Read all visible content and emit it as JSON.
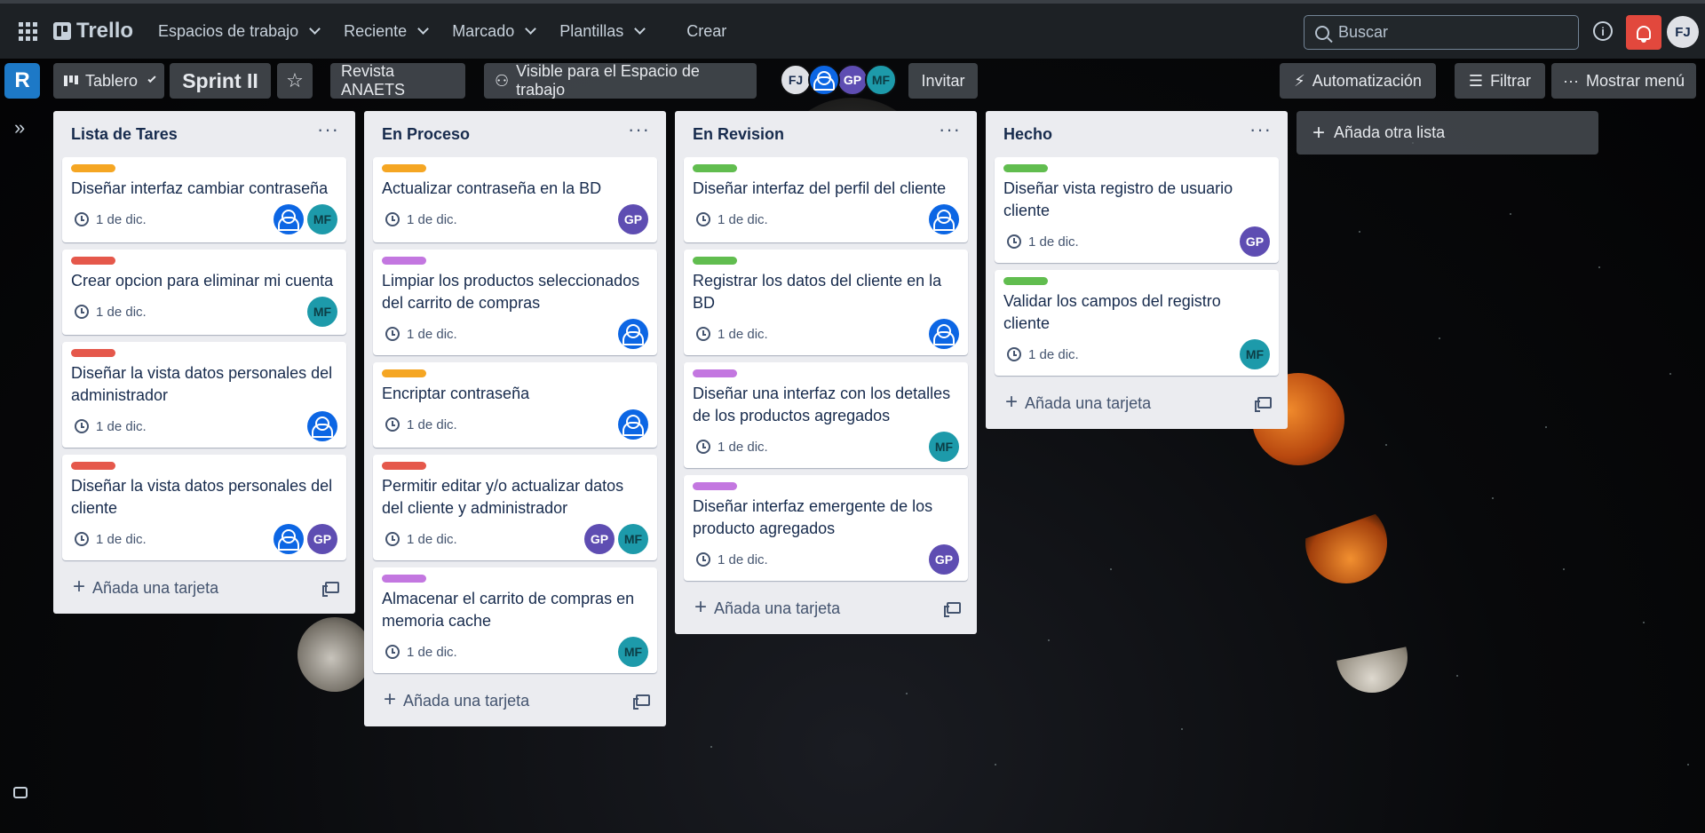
{
  "topnav": {
    "brand": "Trello",
    "menus": [
      "Espacios de trabajo",
      "Reciente",
      "Marcado",
      "Plantillas"
    ],
    "create_label": "Crear",
    "search_placeholder": "Buscar",
    "user_initials": "FJ"
  },
  "board": {
    "workspace_badge": "R",
    "view_label": "Tablero",
    "title": "Sprint II",
    "workspace_name": "Revista ANAETS",
    "visibility_label": "Visible para el Espacio de trabajo",
    "invite_label": "Invitar",
    "automation_label": "Automatización",
    "filter_label": "Filtrar",
    "menu_label": "Mostrar menú",
    "members": [
      "FJ",
      "",
      "GP",
      "MF"
    ]
  },
  "colors": {
    "orange": "#f5a623",
    "red": "#e5584b",
    "purple": "#c377e0",
    "green": "#61bd4f"
  },
  "lists": [
    {
      "title": "Lista de Tares",
      "add_card_label": "Añada una tarjeta",
      "cards": [
        {
          "label_color": "orange",
          "title": "Diseñar interfaz cambiar contraseña",
          "due": "1 de dic.",
          "members": [
            "person",
            "MF"
          ]
        },
        {
          "label_color": "red",
          "title": "Crear opcion para eliminar mi cuenta",
          "due": "1 de dic.",
          "members": [
            "MF"
          ]
        },
        {
          "label_color": "red",
          "title": "Diseñar la vista datos personales del administrador",
          "due": "1 de dic.",
          "members": [
            "person"
          ]
        },
        {
          "label_color": "red",
          "title": "Diseñar la vista datos personales del cliente",
          "due": "1 de dic.",
          "members": [
            "person",
            "GP"
          ]
        }
      ]
    },
    {
      "title": "En Proceso",
      "add_card_label": "Añada una tarjeta",
      "cards": [
        {
          "label_color": "orange",
          "title": "Actualizar contraseña en la BD",
          "due": "1 de dic.",
          "members": [
            "GP"
          ]
        },
        {
          "label_color": "purple",
          "title": "Limpiar los productos seleccionados del carrito de compras",
          "due": "1 de dic.",
          "members": [
            "person"
          ]
        },
        {
          "label_color": "orange",
          "title": "Encriptar contraseña",
          "due": "1 de dic.",
          "members": [
            "person"
          ]
        },
        {
          "label_color": "red",
          "title": "Permitir editar y/o actualizar datos del cliente y administrador",
          "due": "1 de dic.",
          "members": [
            "GP",
            "MF"
          ]
        },
        {
          "label_color": "purple",
          "title": "Almacenar el carrito de compras en memoria cache",
          "due": "1 de dic.",
          "members": [
            "MF"
          ]
        }
      ]
    },
    {
      "title": "En Revision",
      "add_card_label": "Añada una tarjeta",
      "cards": [
        {
          "label_color": "green",
          "title": "Diseñar interfaz del perfil del cliente",
          "due": "1 de dic.",
          "members": [
            "person"
          ]
        },
        {
          "label_color": "green",
          "title": "Registrar los datos del cliente en la BD",
          "due": "1 de dic.",
          "members": [
            "person"
          ]
        },
        {
          "label_color": "purple",
          "title": "Diseñar una interfaz con los detalles de los productos agregados",
          "due": "1 de dic.",
          "members": [
            "MF"
          ]
        },
        {
          "label_color": "purple",
          "title": "Diseñar interfaz emergente de los producto agregados",
          "due": "1 de dic.",
          "members": [
            "GP"
          ]
        }
      ]
    },
    {
      "title": "Hecho",
      "add_card_label": "Añada una tarjeta",
      "cards": [
        {
          "label_color": "green",
          "title": "Diseñar vista registro de usuario cliente",
          "due": "1 de dic.",
          "members": [
            "GP"
          ]
        },
        {
          "label_color": "green",
          "title": "Validar los campos del registro cliente",
          "due": "1 de dic.",
          "members": [
            "MF"
          ]
        }
      ]
    }
  ],
  "add_list_label": "Añada otra lista"
}
